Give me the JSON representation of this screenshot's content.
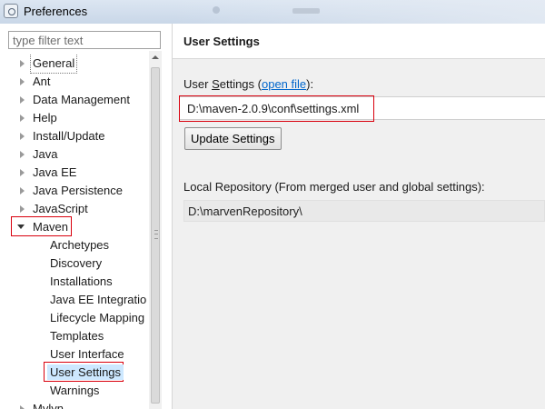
{
  "window": {
    "title": "Preferences",
    "app_icon": "preferences-gear-icon"
  },
  "filter": {
    "placeholder": "type filter text"
  },
  "tree": {
    "items": [
      {
        "label": "General"
      },
      {
        "label": "Ant"
      },
      {
        "label": "Data Management"
      },
      {
        "label": "Help"
      },
      {
        "label": "Install/Update"
      },
      {
        "label": "Java"
      },
      {
        "label": "Java EE"
      },
      {
        "label": "Java Persistence"
      },
      {
        "label": "JavaScript"
      },
      {
        "label": "Maven",
        "expanded": true
      },
      {
        "label": "Mylyn"
      }
    ],
    "maven_children": [
      {
        "label": "Archetypes"
      },
      {
        "label": "Discovery"
      },
      {
        "label": "Installations"
      },
      {
        "label": "Java EE Integration"
      },
      {
        "label": "Lifecycle Mapping"
      },
      {
        "label": "Templates"
      },
      {
        "label": "User Interface"
      },
      {
        "label": "User Settings",
        "selected": true
      },
      {
        "label": "Warnings"
      }
    ]
  },
  "page": {
    "title": "User Settings",
    "user_settings_prefix": "User ",
    "user_settings_mnemonic": "S",
    "user_settings_rest": "ettings (",
    "open_file_link": "open file",
    "user_settings_suffix": "):",
    "user_settings_path": "D:\\maven-2.0.9\\conf\\settings.xml",
    "update_button": "Update Settings",
    "local_repo_label": "Local Repository (From merged user and global settings):",
    "local_repo_path": "D:\\marvenRepository\\"
  },
  "colors": {
    "highlight_outline": "#d9000d",
    "link": "#0066cc",
    "selection": "#cde8ff"
  }
}
